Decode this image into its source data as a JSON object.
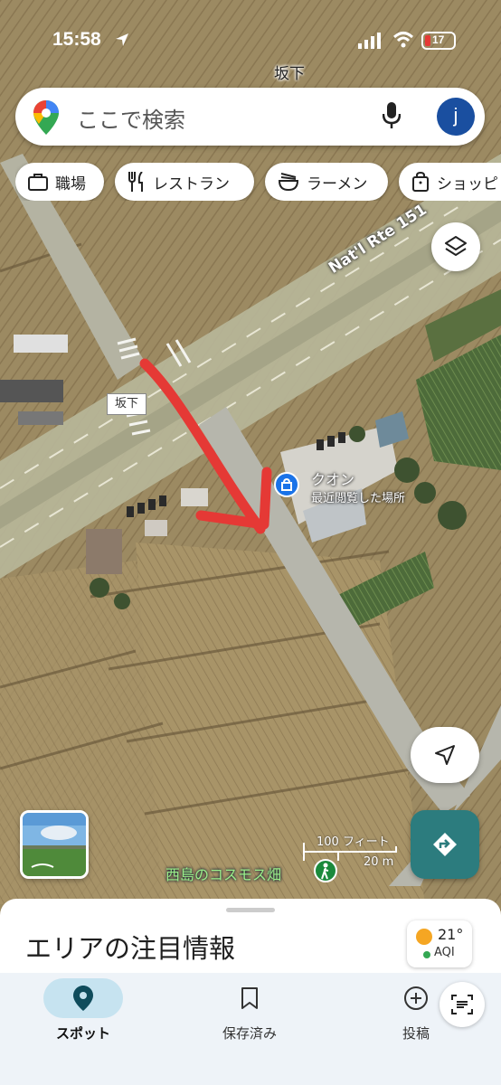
{
  "status_bar": {
    "time": "15:58",
    "battery": "17"
  },
  "map": {
    "top_label": "坂下",
    "road_label": "Nat'l Rte 151",
    "sign_label": "坂下",
    "poi": {
      "name": "クオン",
      "subtitle": "最近閲覧した場所"
    },
    "scale": {
      "feet": "100 フィート",
      "meters": "20 m"
    },
    "landmark_label": "西島のコスモス畑"
  },
  "search": {
    "placeholder": "ここで検索",
    "avatar_initial": "j"
  },
  "chips": [
    {
      "label": "職場",
      "icon": "briefcase-icon"
    },
    {
      "label": "レストラン",
      "icon": "fork-knife-icon"
    },
    {
      "label": "ラーメン",
      "icon": "ramen-bowl-icon"
    },
    {
      "label": "ショッピ",
      "icon": "shopping-bag-icon"
    }
  ],
  "sheet": {
    "title": "エリアの注目情報",
    "weather": {
      "temp": "21°",
      "aqi": "AQI"
    }
  },
  "tabs": [
    {
      "label": "スポット",
      "icon": "location-pin-icon",
      "active": true
    },
    {
      "label": "保存済み",
      "icon": "bookmark-icon",
      "active": false
    },
    {
      "label": "投稿",
      "icon": "add-circle-icon",
      "active": false
    }
  ],
  "colors": {
    "accent_blue": "#1a73e8",
    "directions_teal": "#2c7c7e",
    "active_tab_bg": "#c6e3f0",
    "annotation_red": "#e53935"
  }
}
